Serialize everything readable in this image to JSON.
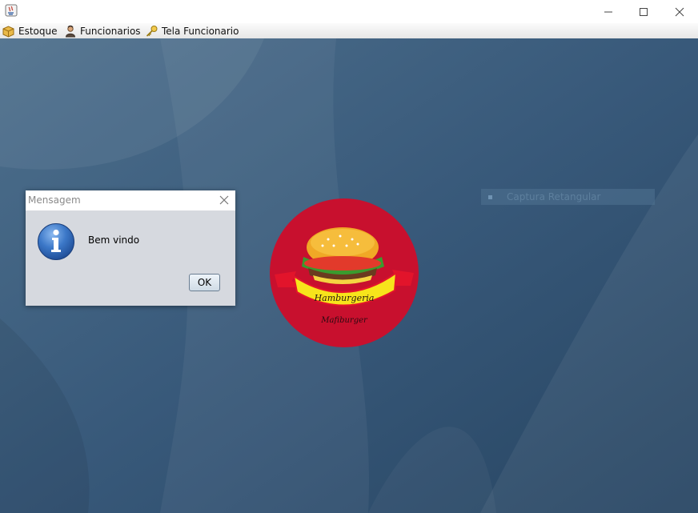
{
  "window": {
    "buttons": [
      "minimize",
      "maximize",
      "close"
    ]
  },
  "menu": {
    "items": [
      {
        "label": "Estoque",
        "icon": "package-icon"
      },
      {
        "label": "Funcionarios",
        "icon": "person-icon"
      },
      {
        "label": "Tela Funcionario",
        "icon": "key-icon"
      }
    ]
  },
  "overlay": {
    "capture_label": "Captura Retangular"
  },
  "dialog": {
    "title": "Mensagem",
    "message": "Bem vindo",
    "ok_label": "OK",
    "icon": "info-icon"
  },
  "logo": {
    "line1": "Hamburgeria",
    "line2": "Mafiburger"
  },
  "colors": {
    "desktop": "#35556f",
    "logo_red": "#c8102e",
    "ribbon_yellow": "#f7e41b"
  }
}
